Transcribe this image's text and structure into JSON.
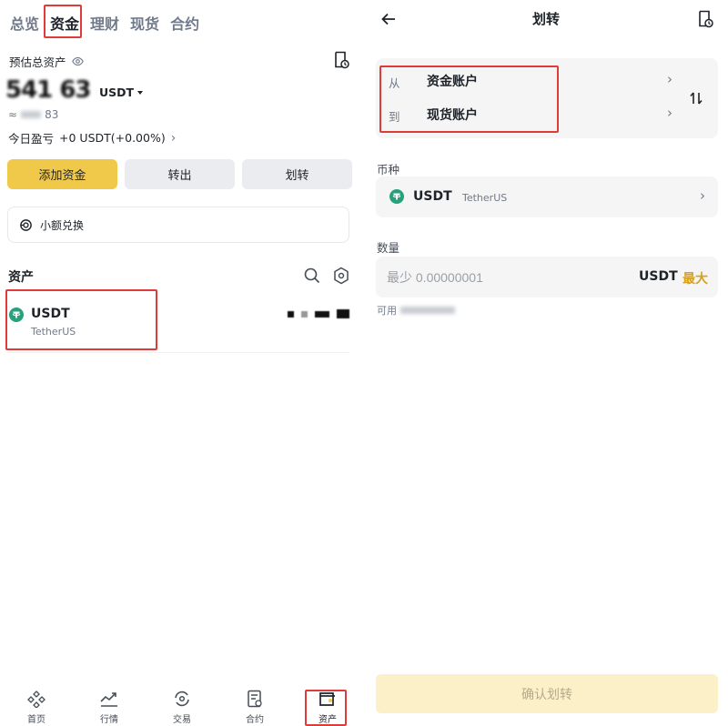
{
  "left": {
    "tabs": [
      {
        "label": "总览"
      },
      {
        "label": "资金"
      },
      {
        "label": "理财"
      },
      {
        "label": "现货"
      },
      {
        "label": "合约"
      }
    ],
    "estimated_total_label": "预估总资产",
    "balance_display": "541 63",
    "balance_unit": "USDT",
    "approx_prefix": "≈",
    "approx_suffix": "83",
    "pnl_label": "今日盈亏",
    "pnl_value": "+0 USDT(+0.00%)",
    "buttons": {
      "add_funds": "添加资金",
      "withdraw": "转出",
      "transfer": "划转"
    },
    "small_exchange": "小额兑换",
    "assets_title": "资产",
    "assets": [
      {
        "symbol": "USDT",
        "name": "TetherUS"
      }
    ],
    "bottom_nav": [
      {
        "label": "首页",
        "icon": "binance-icon"
      },
      {
        "label": "行情",
        "icon": "chart-icon"
      },
      {
        "label": "交易",
        "icon": "trade-icon"
      },
      {
        "label": "合约",
        "icon": "futures-icon"
      },
      {
        "label": "资产",
        "icon": "wallet-icon"
      }
    ]
  },
  "right": {
    "title": "划转",
    "from_label": "从",
    "from_value": "资金账户",
    "to_label": "到",
    "to_value": "现货账户",
    "coin_label": "币种",
    "coin_symbol": "USDT",
    "coin_name": "TetherUS",
    "qty_label": "数量",
    "qty_placeholder": "最少 0.00000001",
    "qty_unit": "USDT",
    "qty_max": "最大",
    "available_label": "可用",
    "confirm": "确认划转"
  },
  "colors": {
    "accent": "#f0c94a",
    "highlight_box": "#e03b3b",
    "usdt_green": "#26a17b",
    "max_text": "#d7a01e"
  }
}
